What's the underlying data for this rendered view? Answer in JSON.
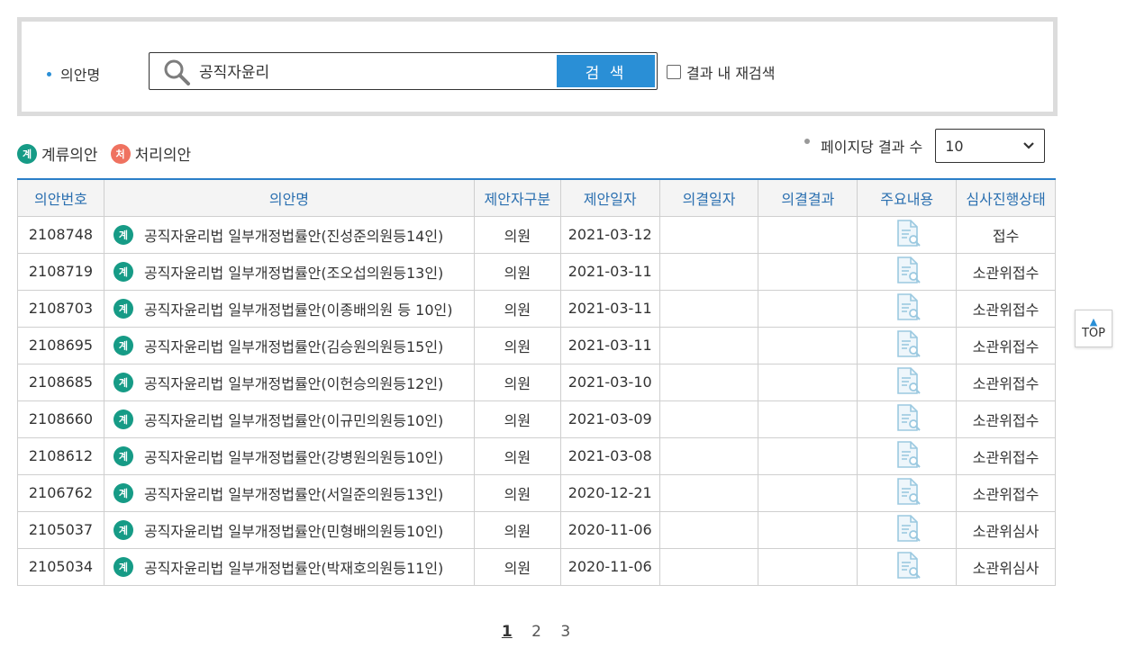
{
  "search": {
    "label": "의안명",
    "value": "공직자윤리",
    "button": "검 색",
    "recheck_label": "결과 내 재검색"
  },
  "legend": {
    "pending_badge": "계",
    "pending_label": "계류의안",
    "processed_badge": "처",
    "processed_label": "처리의안"
  },
  "per_page": {
    "label": "페이지당 결과 수",
    "selected": "10"
  },
  "table": {
    "headers": [
      "의안번호",
      "의안명",
      "제안자구분",
      "제안일자",
      "의결일자",
      "의결결과",
      "주요내용",
      "심사진행상태"
    ],
    "rows": [
      {
        "no": "2108748",
        "badge": "계",
        "title": "공직자윤리법 일부개정법률안(진성준의원등14인)",
        "proposer": "의원",
        "date": "2021-03-12",
        "decision_date": "",
        "result": "",
        "status": "접수"
      },
      {
        "no": "2108719",
        "badge": "계",
        "title": "공직자윤리법 일부개정법률안(조오섭의원등13인)",
        "proposer": "의원",
        "date": "2021-03-11",
        "decision_date": "",
        "result": "",
        "status": "소관위접수"
      },
      {
        "no": "2108703",
        "badge": "계",
        "title": "공직자윤리법 일부개정법률안(이종배의원 등 10인)",
        "proposer": "의원",
        "date": "2021-03-11",
        "decision_date": "",
        "result": "",
        "status": "소관위접수"
      },
      {
        "no": "2108695",
        "badge": "계",
        "title": "공직자윤리법 일부개정법률안(김승원의원등15인)",
        "proposer": "의원",
        "date": "2021-03-11",
        "decision_date": "",
        "result": "",
        "status": "소관위접수"
      },
      {
        "no": "2108685",
        "badge": "계",
        "title": "공직자윤리법 일부개정법률안(이헌승의원등12인)",
        "proposer": "의원",
        "date": "2021-03-10",
        "decision_date": "",
        "result": "",
        "status": "소관위접수"
      },
      {
        "no": "2108660",
        "badge": "계",
        "title": "공직자윤리법 일부개정법률안(이규민의원등10인)",
        "proposer": "의원",
        "date": "2021-03-09",
        "decision_date": "",
        "result": "",
        "status": "소관위접수"
      },
      {
        "no": "2108612",
        "badge": "계",
        "title": "공직자윤리법 일부개정법률안(강병원의원등10인)",
        "proposer": "의원",
        "date": "2021-03-08",
        "decision_date": "",
        "result": "",
        "status": "소관위접수"
      },
      {
        "no": "2106762",
        "badge": "계",
        "title": "공직자윤리법 일부개정법률안(서일준의원등13인)",
        "proposer": "의원",
        "date": "2020-12-21",
        "decision_date": "",
        "result": "",
        "status": "소관위접수"
      },
      {
        "no": "2105037",
        "badge": "계",
        "title": "공직자윤리법 일부개정법률안(민형배의원등10인)",
        "proposer": "의원",
        "date": "2020-11-06",
        "decision_date": "",
        "result": "",
        "status": "소관위심사"
      },
      {
        "no": "2105034",
        "badge": "계",
        "title": "공직자윤리법 일부개정법률안(박재호의원등11인)",
        "proposer": "의원",
        "date": "2020-11-06",
        "decision_date": "",
        "result": "",
        "status": "소관위심사"
      }
    ]
  },
  "pagination": {
    "pages": [
      "1",
      "2",
      "3"
    ],
    "current": "1"
  },
  "top_button": {
    "arrow": "▲",
    "label": "TOP"
  },
  "colors": {
    "accent": "#2a8fd6",
    "pending_badge": "#169b86",
    "processed_badge": "#ef7260",
    "header_text": "#2a6fb0"
  }
}
